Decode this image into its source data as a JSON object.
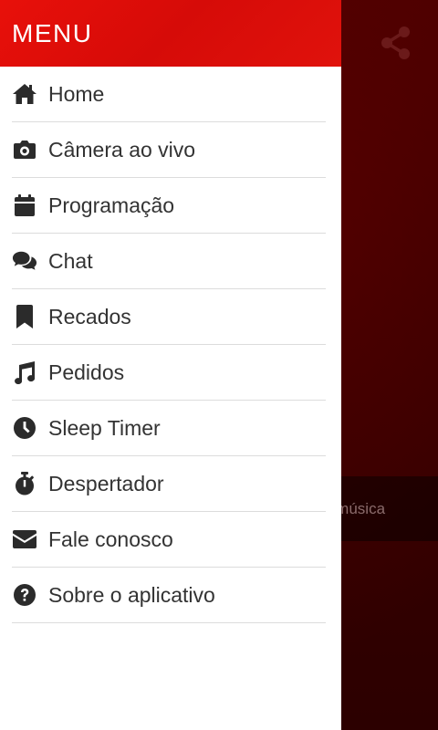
{
  "drawer": {
    "title": "MENU",
    "items": [
      {
        "label": "Home",
        "icon": "home-icon"
      },
      {
        "label": "Câmera ao vivo",
        "icon": "camera-icon"
      },
      {
        "label": "Programação",
        "icon": "calendar-icon"
      },
      {
        "label": "Chat",
        "icon": "chat-icon"
      },
      {
        "label": "Recados",
        "icon": "bookmark-icon"
      },
      {
        "label": "Pedidos",
        "icon": "music-icon"
      },
      {
        "label": "Sleep Timer",
        "icon": "clock-icon"
      },
      {
        "label": "Despertador",
        "icon": "stopwatch-icon"
      },
      {
        "label": "Fale conosco",
        "icon": "envelope-icon"
      },
      {
        "label": "Sobre o aplicativo",
        "icon": "question-circle-icon"
      }
    ]
  },
  "background": {
    "share_icon": "share-icon",
    "now_playing_text": "a música"
  },
  "colors": {
    "header": "#e0120c",
    "background": "#3a0000",
    "menu_text": "#333333",
    "divider": "#dcdcdc"
  }
}
